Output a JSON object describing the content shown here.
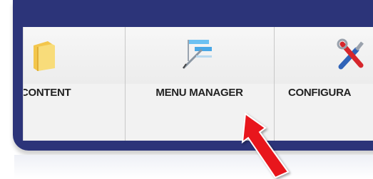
{
  "toolbar": {
    "items": [
      {
        "label": "CONTENT",
        "icon": "folder-icon"
      },
      {
        "label": "MENU MANAGER",
        "icon": "menu-icon"
      },
      {
        "label": "CONFIGURA",
        "icon": "tools-icon"
      }
    ]
  },
  "colors": {
    "frame": "#2c3479",
    "toolbar_bg": "#f2f2f2",
    "arrow": "#e8161c",
    "label": "#222222"
  },
  "annotation": {
    "icon": "red-arrow-icon"
  }
}
